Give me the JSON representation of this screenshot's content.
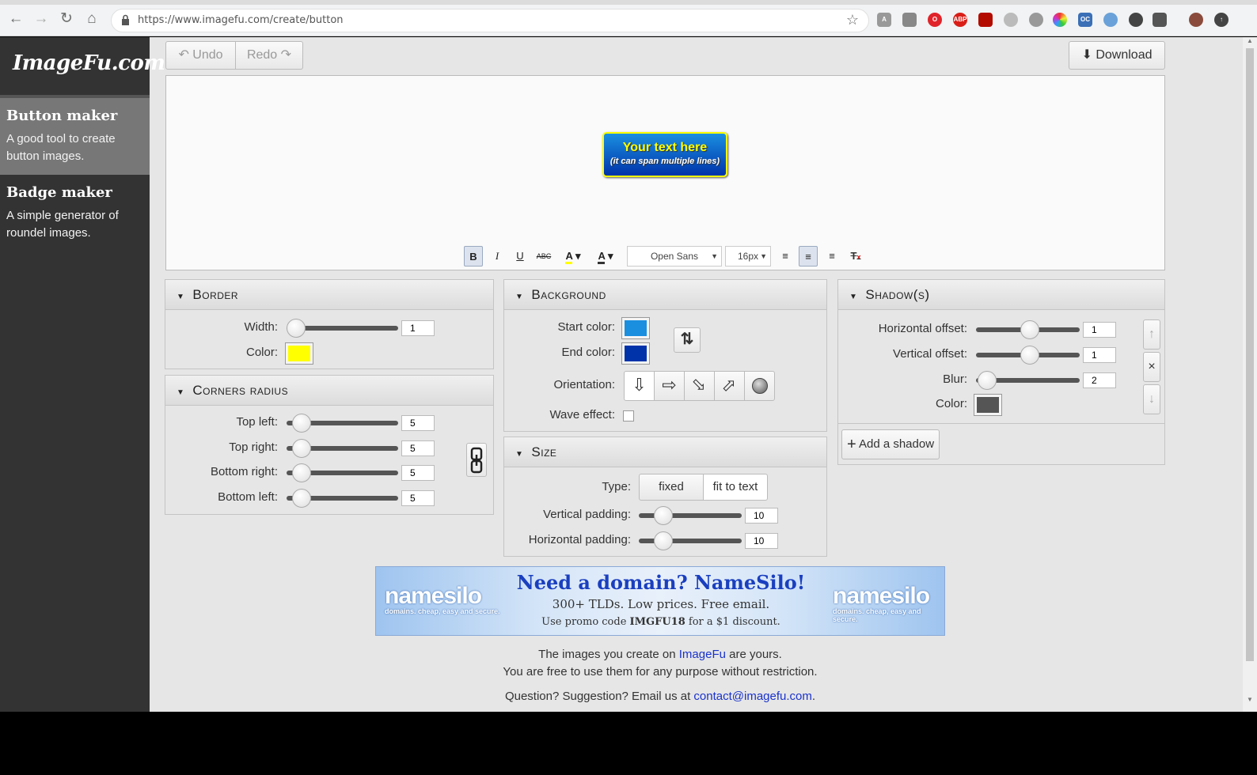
{
  "browser": {
    "url": "https://www.imagefu.com/create/button",
    "extensions": [
      "translate-icon",
      "ext-icon",
      "opera-icon",
      "adblock-icon",
      "pdf-icon",
      "record-icon",
      "circle-icon",
      "color-wheel-icon",
      "oc-icon",
      "snowflake-icon",
      "compass-icon",
      "crown-icon",
      "avatar-icon",
      "update-icon"
    ]
  },
  "sidebar": {
    "logo": "ImageFu.com",
    "items": [
      {
        "title": "Button maker",
        "desc": "A good tool to create button images."
      },
      {
        "title": "Badge maker",
        "desc": "A simple generator of roundel images."
      }
    ]
  },
  "toolbar": {
    "undo": "Undo",
    "redo": "Redo",
    "download": "Download"
  },
  "preview": {
    "line1": "Your text here",
    "line2": "(it can span multiple lines)"
  },
  "format": {
    "bold": "B",
    "italic": "I",
    "underline": "U",
    "strike": "ABC",
    "font": "Open Sans",
    "size": "16px"
  },
  "border": {
    "title": "Border",
    "width_label": "Width:",
    "width_value": "1",
    "color_label": "Color:",
    "color": "#ffff00"
  },
  "corners": {
    "title": "Corners radius",
    "rows": [
      {
        "label": "Top left:",
        "value": "5"
      },
      {
        "label": "Top right:",
        "value": "5"
      },
      {
        "label": "Bottom right:",
        "value": "5"
      },
      {
        "label": "Bottom left:",
        "value": "5"
      }
    ]
  },
  "background": {
    "title": "Background",
    "start_label": "Start color:",
    "start_color": "#1a8fe0",
    "end_label": "End color:",
    "end_color": "#0033aa",
    "orientation_label": "Orientation:",
    "wave_label": "Wave effect:"
  },
  "size": {
    "title": "Size",
    "type_label": "Type:",
    "type_options": [
      "fixed",
      "fit to text"
    ],
    "vpad_label": "Vertical padding:",
    "vpad_value": "10",
    "hpad_label": "Horizontal padding:",
    "hpad_value": "10"
  },
  "shadow": {
    "title": "Shadow(s)",
    "h_label": "Horizontal offset:",
    "h_value": "1",
    "v_label": "Vertical offset:",
    "v_value": "1",
    "blur_label": "Blur:",
    "blur_value": "2",
    "color_label": "Color:",
    "color": "#555555",
    "add_label": "Add a shadow"
  },
  "ad": {
    "brand": "namesilo",
    "tagline": "domains. cheap, easy and secure.",
    "headline": "Need a domain? NameSilo!",
    "sub": "300+ TLDs. Low prices. Free email.",
    "promo_pre": "Use promo code ",
    "promo_code": "IMGFU18",
    "promo_post": " for a $1 discount."
  },
  "footer": {
    "line1_pre": "The images you create on ",
    "line1_link": "ImageFu",
    "line1_post": " are yours.",
    "line2": "You are free to use them for any purpose without restriction.",
    "line3_pre": "Question? Suggestion? Email us at ",
    "line3_link": "contact@imagefu.com",
    "line3_post": "."
  }
}
